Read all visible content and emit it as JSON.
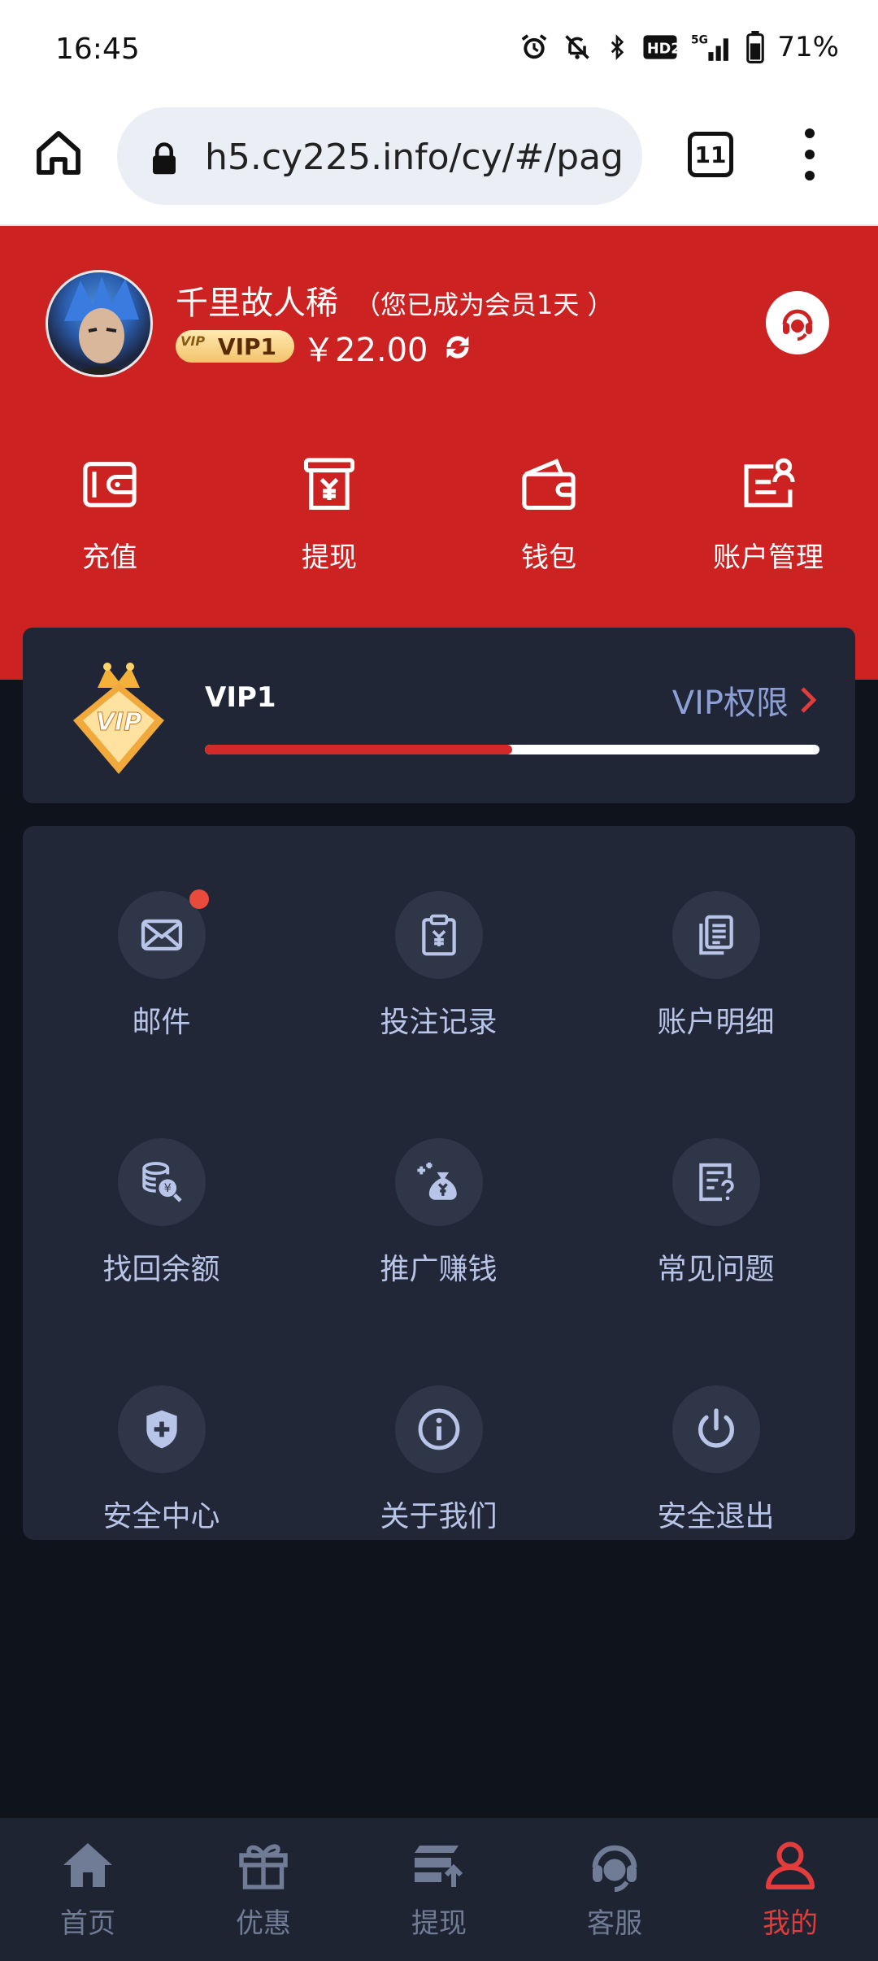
{
  "status_bar": {
    "time": "16:45",
    "battery": "71%",
    "icons": [
      "alarm-icon",
      "mute-icon",
      "bluetooth-icon",
      "hd-icon",
      "signal-5g-icon",
      "battery-icon"
    ]
  },
  "browser": {
    "url": "h5.cy225.info/cy/#/pag",
    "tab_count": "11"
  },
  "profile": {
    "username": "千里故人稀",
    "member_note": "（您已成为会员1天 ）",
    "vip_badge": "VIP1",
    "vip_badge_mini": "VIP",
    "balance": "￥22.00"
  },
  "quick_actions": [
    {
      "label": "充值",
      "icon": "recharge-wallet-icon"
    },
    {
      "label": "提现",
      "icon": "withdraw-yen-icon"
    },
    {
      "label": "钱包",
      "icon": "wallet-icon"
    },
    {
      "label": "账户管理",
      "icon": "account-card-icon"
    }
  ],
  "vip_card": {
    "level": "VIP1",
    "rights_label": "VIP权限",
    "emblem_text": "VIP",
    "progress_fraction": 0.5
  },
  "menu": [
    {
      "label": "邮件",
      "icon": "mail-icon",
      "unread": true
    },
    {
      "label": "投注记录",
      "icon": "clipboard-yen-icon",
      "unread": false
    },
    {
      "label": "账户明细",
      "icon": "documents-icon",
      "unread": false
    },
    {
      "label": "找回余额",
      "icon": "coins-search-icon",
      "unread": false
    },
    {
      "label": "推广赚钱",
      "icon": "money-bag-icon",
      "unread": false
    },
    {
      "label": "常见问题",
      "icon": "faq-list-icon",
      "unread": false
    },
    {
      "label": "安全中心",
      "icon": "shield-icon",
      "unread": false
    },
    {
      "label": "关于我们",
      "icon": "info-icon",
      "unread": false
    },
    {
      "label": "安全退出",
      "icon": "power-icon",
      "unread": false
    }
  ],
  "bottom_nav": [
    {
      "label": "首页",
      "icon": "home-icon",
      "active": false
    },
    {
      "label": "优惠",
      "icon": "gift-icon",
      "active": false
    },
    {
      "label": "提现",
      "icon": "withdraw-card-icon",
      "active": false
    },
    {
      "label": "客服",
      "icon": "headset-icon",
      "active": false
    },
    {
      "label": "我的",
      "icon": "user-icon",
      "active": true
    }
  ],
  "colors": {
    "header_red": "#cc2222",
    "page_bg": "#0f131c",
    "card_bg": "#212737",
    "accent_red": "#e23c3c",
    "menu_label": "#b9c5e8"
  }
}
